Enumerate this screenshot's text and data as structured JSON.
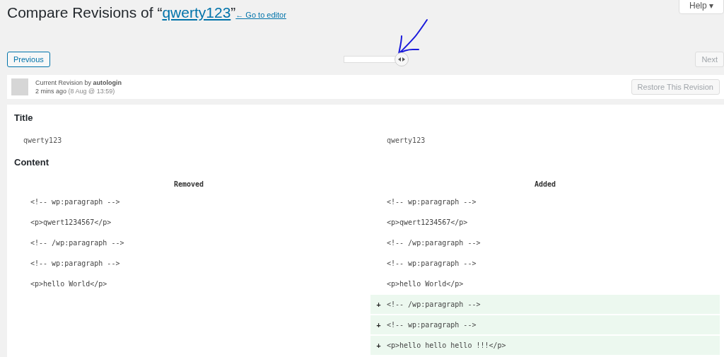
{
  "header": {
    "title_prefix": "Compare Revisions of “",
    "title_link": "qwerty123",
    "title_suffix": "”",
    "back_link": "← Go to editor",
    "help": "Help ▾"
  },
  "nav": {
    "previous": "Previous",
    "next": "Next",
    "next_disabled": true,
    "slider": {
      "level": 1
    }
  },
  "revision": {
    "line": "Current Revision by **autologin**",
    "time": "2 mins ago",
    "date": "(8 Aug @ 13:59)",
    "restore": "Restore This Revision",
    "restore_disabled": true
  },
  "sections": [
    {
      "heading": "Title",
      "kind": "plain",
      "left": "qwerty123",
      "right": "qwerty123"
    },
    {
      "heading": "Content",
      "kind": "diff",
      "removed_label": "Removed",
      "added_label": "Added",
      "rows": [
        {
          "kind": "context",
          "left": "<!-- wp:paragraph -->",
          "right": "<!-- wp:paragraph -->"
        },
        {
          "kind": "context",
          "left": "<p>qwert1234567</p>",
          "right": "<p>qwert1234567</p>"
        },
        {
          "kind": "context",
          "left": "<!-- /wp:paragraph -->",
          "right": "<!-- /wp:paragraph -->"
        },
        {
          "kind": "context",
          "left": "<!-- wp:paragraph -->",
          "right": "<!-- wp:paragraph -->"
        },
        {
          "kind": "context",
          "left": "<p>hello World</p>",
          "right": "<p>hello World</p>"
        },
        {
          "kind": "added",
          "marker": "+",
          "right": "<!-- /wp:paragraph -->"
        },
        {
          "kind": "added",
          "marker": "+",
          "right": "<!-- wp:paragraph -->"
        },
        {
          "kind": "added",
          "marker": "+",
          "right": "<p>hello hello hello !!!</p>"
        }
      ]
    }
  ]
}
